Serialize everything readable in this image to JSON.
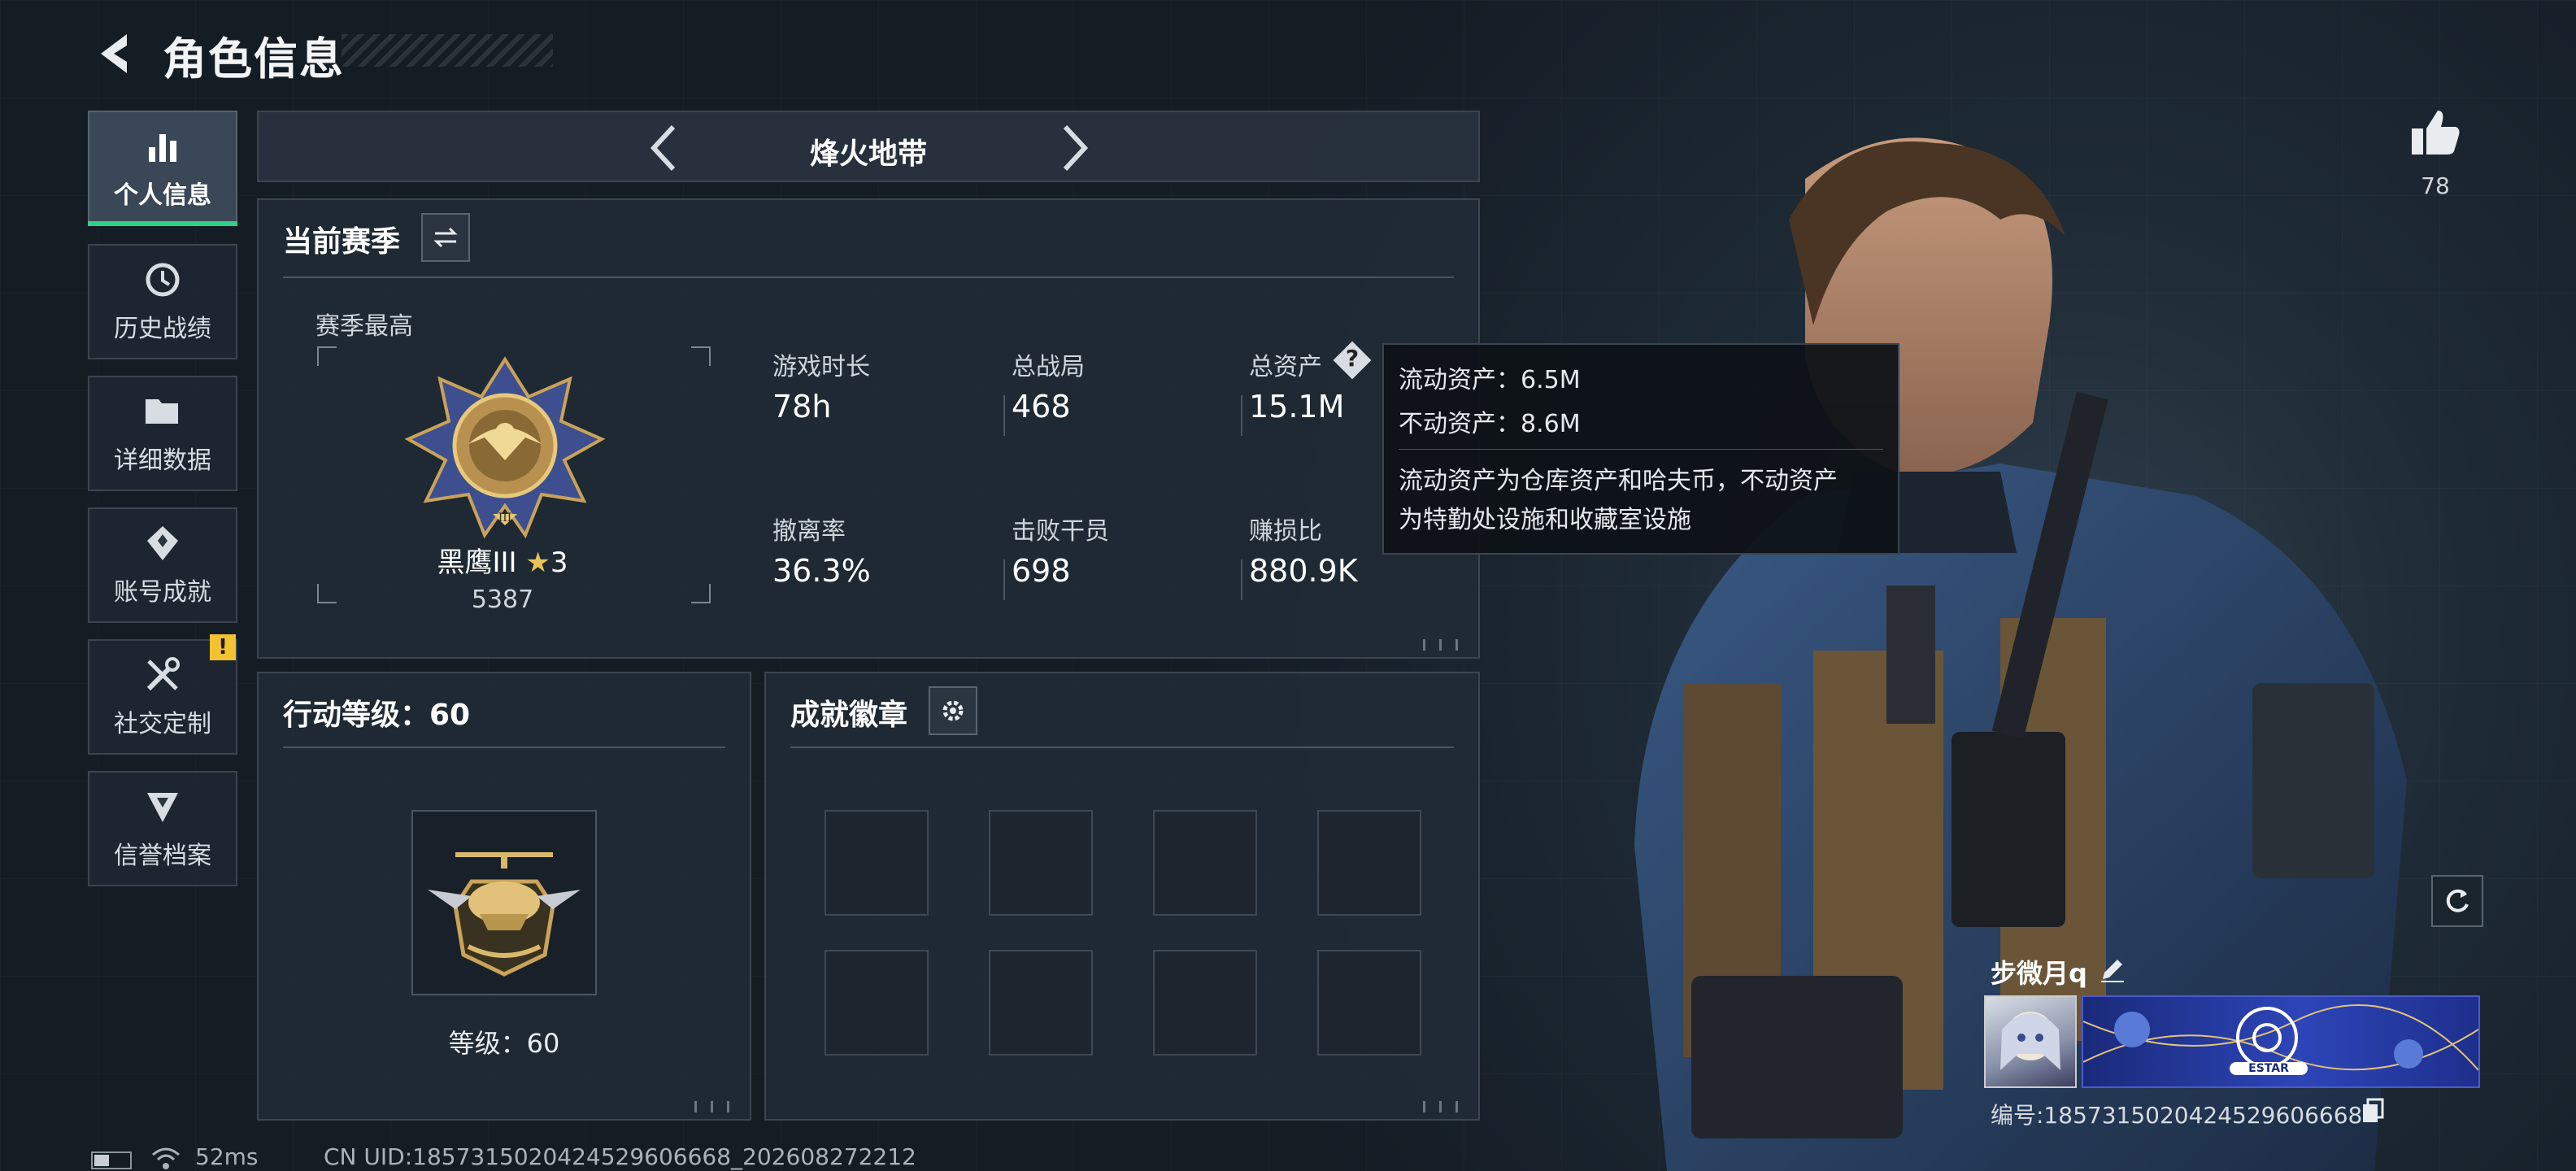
{
  "header": {
    "title": "角色信息"
  },
  "sidebar": {
    "items": [
      {
        "label": "个人信息",
        "icon": "bar-chart-icon"
      },
      {
        "label": "历史战绩",
        "icon": "history-icon"
      },
      {
        "label": "详细数据",
        "icon": "folder-icon"
      },
      {
        "label": "账号成就",
        "icon": "achievement-icon"
      },
      {
        "label": "社交定制",
        "icon": "tools-icon"
      },
      {
        "label": "信誉档案",
        "icon": "shield-icon"
      }
    ],
    "warning_badge": "!"
  },
  "mode_selector": {
    "current": "烽火地带"
  },
  "season": {
    "title": "当前赛季",
    "highest_label": "赛季最高",
    "rank_name": "黑鹰III",
    "rank_stars": "3",
    "rank_score": "5387",
    "stats": [
      {
        "label": "游戏时长",
        "value": "78h"
      },
      {
        "label": "总战局",
        "value": "468"
      },
      {
        "label": "总资产",
        "value": "15.1M"
      },
      {
        "label": "撤离率",
        "value": "36.3%"
      },
      {
        "label": "击败干员",
        "value": "698"
      },
      {
        "label": "赚损比",
        "value": "880.9K"
      }
    ],
    "help_symbol": "?"
  },
  "asset_tooltip": {
    "liquid": "流动资产：6.5M",
    "fixed": "不动资产：8.6M",
    "desc_line1": "流动资产为仓库资产和哈夫币，不动资产",
    "desc_line2": "为特勤处设施和收藏室设施"
  },
  "action_level": {
    "title": "行动等级：60",
    "level_text": "等级：60"
  },
  "badges": {
    "title": "成就徽章",
    "slot_count": 8
  },
  "profile": {
    "likes": "78",
    "nickname": "步微月q",
    "uid_line": "编号:1857315020424529606668",
    "banner_text": "ESTAR"
  },
  "status_bar": {
    "ping": "52ms",
    "cn_uid": "CN UID:1857315020424529606668_202608272212"
  },
  "colors": {
    "accent": "#2fd189",
    "warning": "#f2c230",
    "star": "#e8c35a"
  }
}
